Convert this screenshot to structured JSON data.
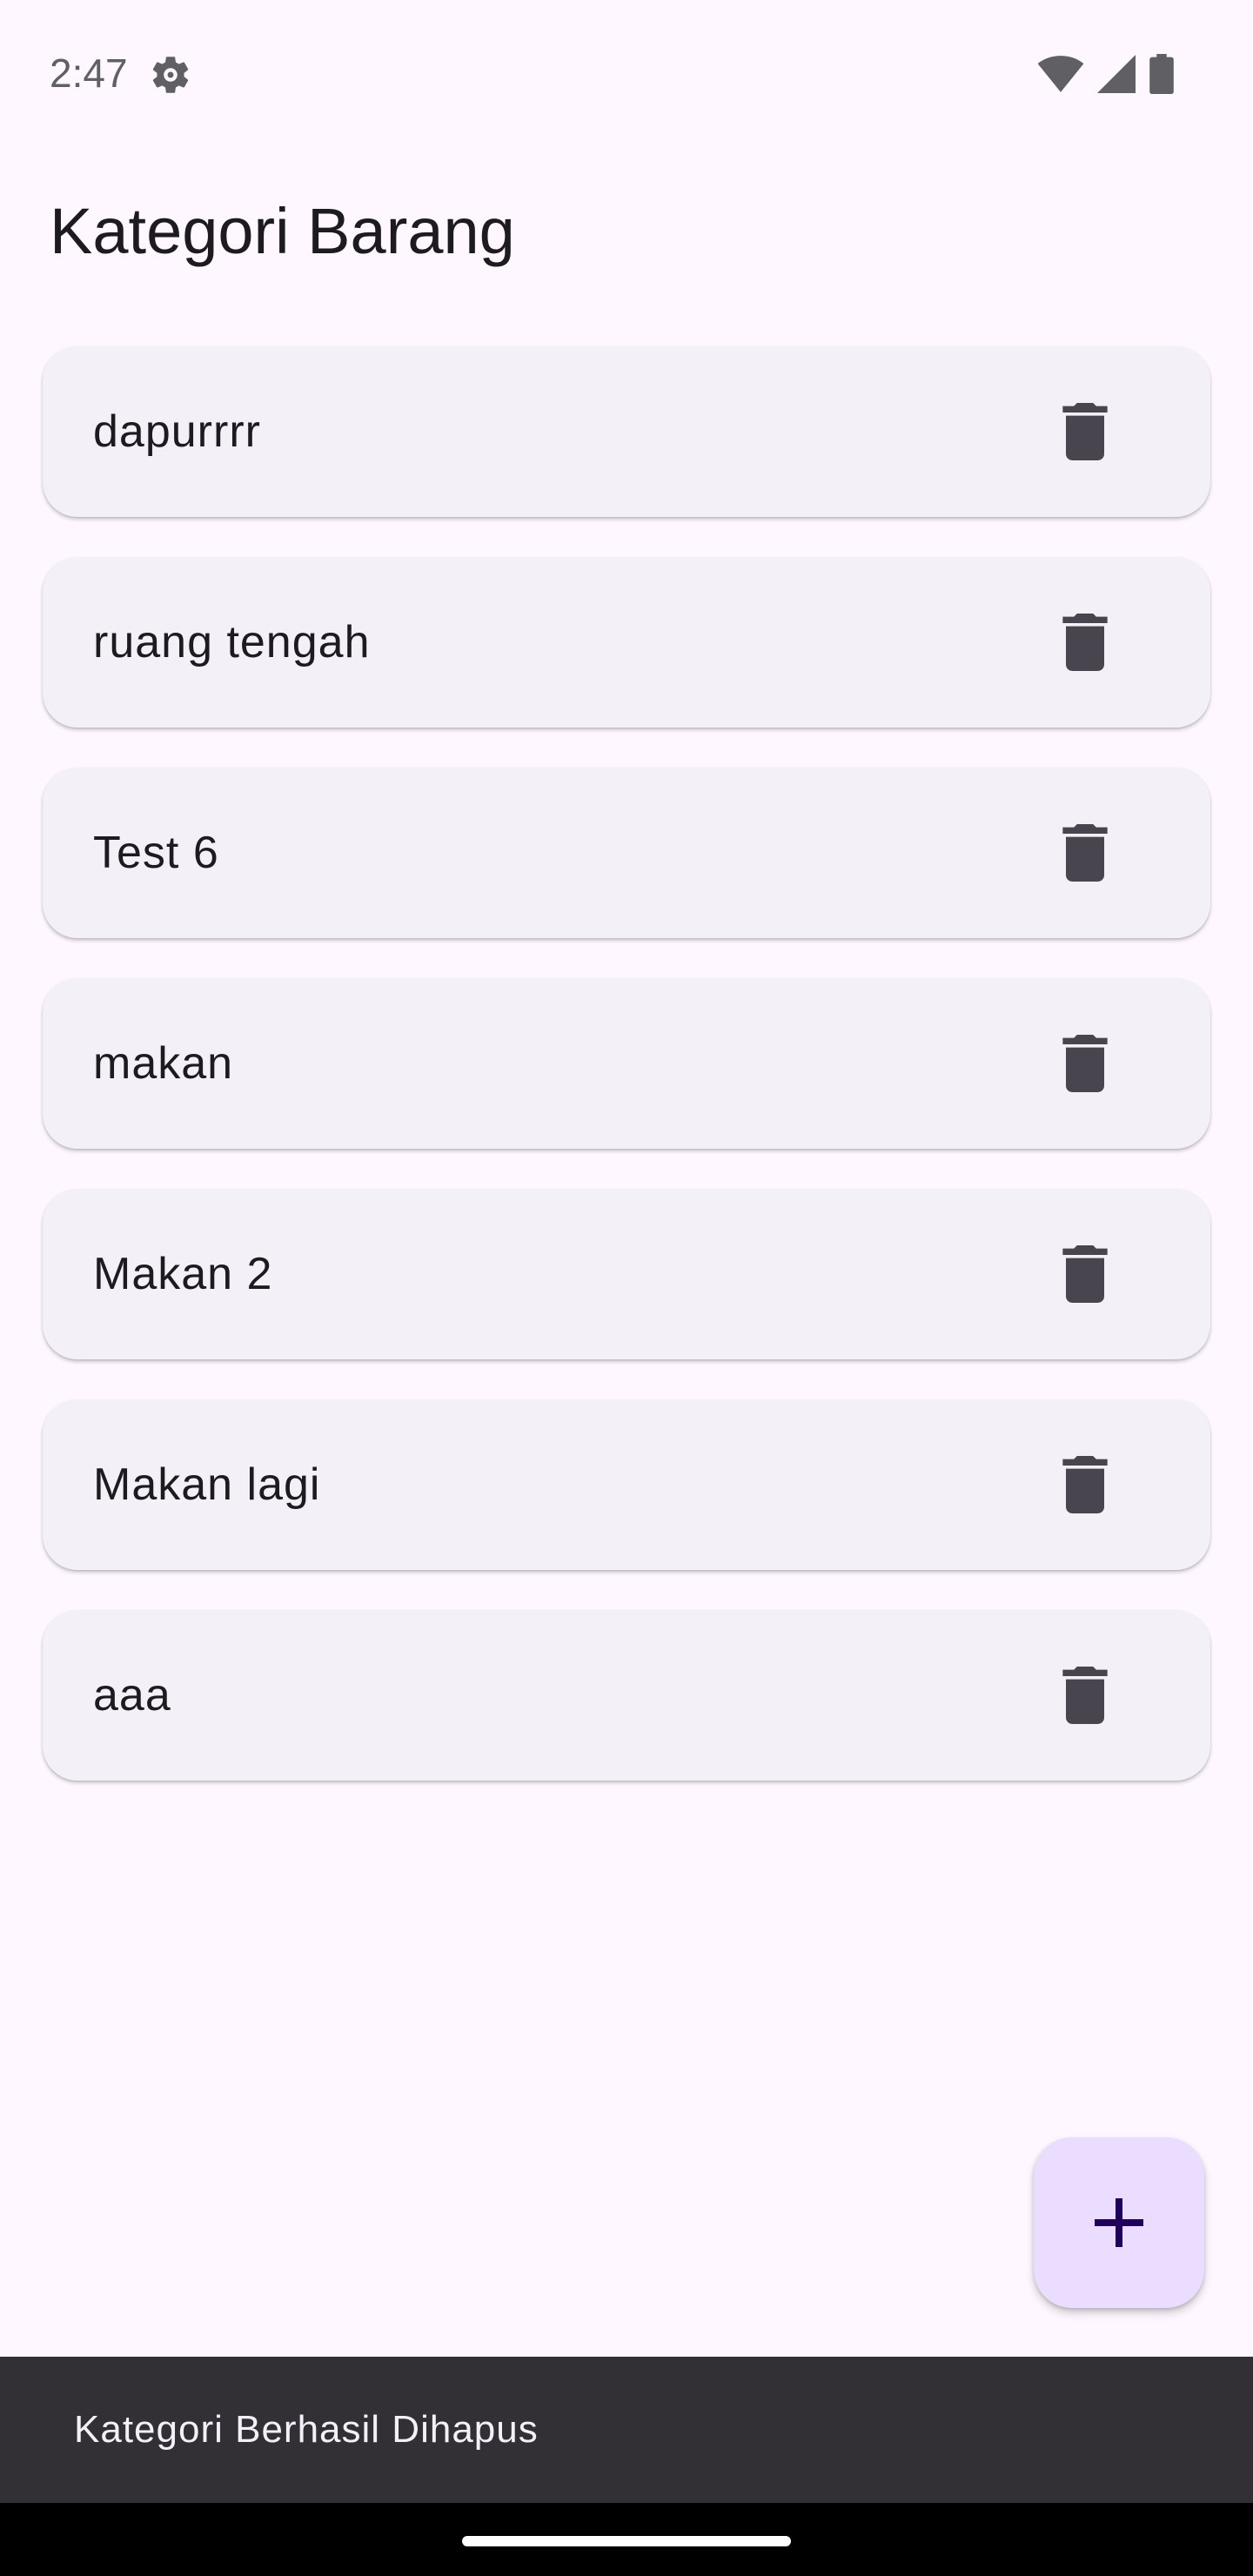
{
  "status_bar": {
    "time": "2:47"
  },
  "page": {
    "title": "Kategori Barang"
  },
  "categories": [
    {
      "name": "dapurrrr"
    },
    {
      "name": "ruang tengah"
    },
    {
      "name": "Test 6"
    },
    {
      "name": "makan"
    },
    {
      "name": "Makan 2"
    },
    {
      "name": "Makan lagi"
    },
    {
      "name": "aaa"
    }
  ],
  "icons": {
    "delete": "trash-icon",
    "add": "plus-icon",
    "settings": "gear-icon",
    "wifi": "wifi-icon",
    "signal": "signal-icon",
    "battery": "battery-icon"
  },
  "snackbar": {
    "message": "Kategori Berhasil Dihapus"
  },
  "colors": {
    "background": "#FEF7FF",
    "card": "#F4F0F8",
    "fab": "#EADDFF",
    "snackbar": "#322F35",
    "icon": "#49454F"
  }
}
